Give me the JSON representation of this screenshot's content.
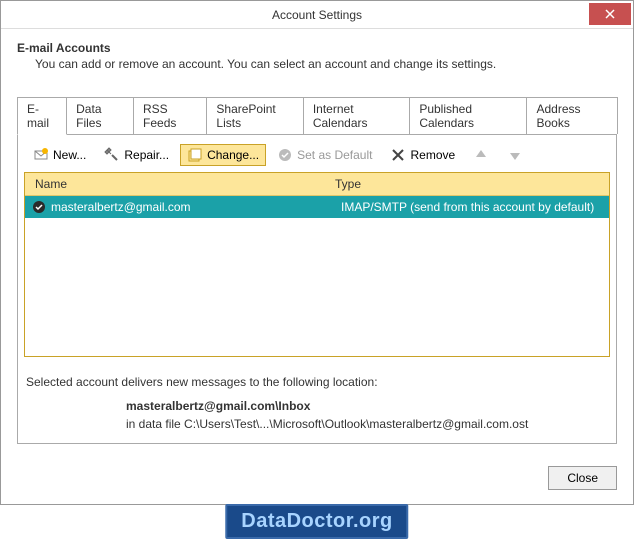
{
  "titlebar": {
    "title": "Account Settings"
  },
  "header": {
    "title": "E-mail Accounts",
    "description": "You can add or remove an account. You can select an account and change its settings."
  },
  "tabs": [
    {
      "label": "E-mail",
      "active": true
    },
    {
      "label": "Data Files"
    },
    {
      "label": "RSS Feeds"
    },
    {
      "label": "SharePoint Lists"
    },
    {
      "label": "Internet Calendars"
    },
    {
      "label": "Published Calendars"
    },
    {
      "label": "Address Books"
    }
  ],
  "toolbar": {
    "new": "New...",
    "repair": "Repair...",
    "change": "Change...",
    "set_default": "Set as Default",
    "remove": "Remove"
  },
  "table": {
    "columns": {
      "name": "Name",
      "type": "Type"
    },
    "rows": [
      {
        "name": "masteralbertz@gmail.com",
        "type": "IMAP/SMTP (send from this account by default)"
      }
    ]
  },
  "info": {
    "line1": "Selected account delivers new messages to the following location:",
    "email_location": "masteralbertz@gmail.com\\Inbox",
    "data_file": "in data file C:\\Users\\Test\\...\\Microsoft\\Outlook\\masteralbertz@gmail.com.ost"
  },
  "footer": {
    "close": "Close"
  },
  "watermark": "DataDoctor.org"
}
